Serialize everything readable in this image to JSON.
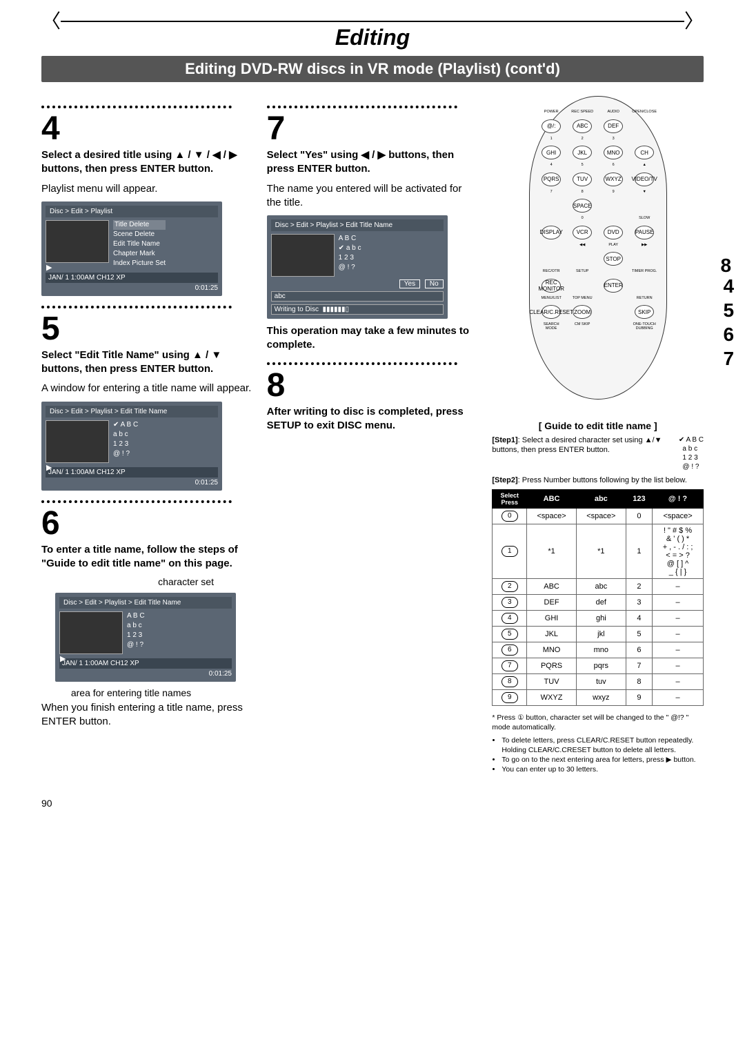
{
  "header": {
    "chapter": "Editing",
    "section": "Editing DVD-RW discs in VR mode (Playlist) (cont'd)"
  },
  "page_number": "90",
  "steps": {
    "s4": {
      "num": "4",
      "title": "Select a desired title using ▲ / ▼ / ◀ / ▶ buttons, then press ENTER button.",
      "body": "Playlist menu will appear."
    },
    "s5": {
      "num": "5",
      "title": "Select \"Edit Title Name\" using ▲ / ▼ buttons, then press ENTER button.",
      "body": "A window for entering a title name will appear."
    },
    "s6": {
      "num": "6",
      "title": "To enter a title name, follow the steps of \"Guide to edit title name\" on this page.",
      "cap1": "character set",
      "cap2": "area for entering title names",
      "body": "When you finish entering a title name, press ENTER button."
    },
    "s7": {
      "num": "7",
      "title": "Select \"Yes\" using ◀ / ▶ buttons, then press ENTER button.",
      "body": "The name you entered will be activated for the title.",
      "note": "This operation may take a few minutes to complete."
    },
    "s8": {
      "num": "8",
      "title": "After writing to disc is completed, press SETUP to exit DISC menu."
    }
  },
  "osd": {
    "crumb_playlist": "Disc > Edit > Playlist",
    "crumb_edit_title": "Disc > Edit > Playlist > Edit Title Name",
    "menu_items": {
      "title_delete": "Title Delete",
      "scene_delete": "Scene Delete",
      "edit_title_name": "Edit Title Name",
      "chapter_mark": "Chapter Mark",
      "index_picture": "Index Picture Set"
    },
    "status_line": "JAN/ 1   1:00AM   CH12    XP",
    "time": "0:01:25",
    "charset": {
      "l1": "A B C",
      "l2": "a b c",
      "l3": "1 2 3",
      "l4": "@ ! ?"
    },
    "yes": "Yes",
    "no": "No",
    "abc_field": "abc",
    "writing": "Writing to Disc"
  },
  "remote": {
    "side_labels": {
      "a": "8",
      "b": "4",
      "c": "5",
      "d": "6",
      "e": "7"
    },
    "rows": [
      [
        "POWER",
        "REC SPEED",
        "AUDIO",
        "OPEN/CLOSE"
      ],
      [
        "@/:",
        "ABC",
        "DEF",
        ""
      ],
      [
        "1",
        "2",
        "3",
        ""
      ],
      [
        "GHI",
        "JKL",
        "MNO",
        "CH"
      ],
      [
        "4",
        "5",
        "6",
        "▲"
      ],
      [
        "PQRS",
        "TUV",
        "WXYZ",
        "VIDEO/TV"
      ],
      [
        "7",
        "8",
        "9",
        "▼"
      ],
      [
        "",
        "SPACE",
        "",
        ""
      ],
      [
        "",
        "0",
        "",
        "SLOW"
      ],
      [
        "DISPLAY",
        "VCR",
        "DVD",
        "PAUSE"
      ],
      [
        "",
        "◀◀",
        "PLAY",
        "▶▶"
      ],
      [
        "",
        "",
        "STOP",
        ""
      ],
      [
        "REC/OTR",
        "SETUP",
        "",
        "TIMER PROG."
      ],
      [
        "REC MONITOR",
        "",
        "ENTER",
        ""
      ],
      [
        "MENU/LIST",
        "TOP MENU",
        "",
        "RETURN"
      ],
      [
        "CLEAR/C.RESET",
        "ZOOM",
        "",
        "SKIP"
      ],
      [
        "SEARCH MODE",
        "CM SKIP",
        "",
        "ONE-TOUCH DUBBING"
      ]
    ]
  },
  "guide": {
    "title": "[ Guide to edit title name ]",
    "step1_label": "[Step1]",
    "step1_text": ": Select a desired character set using ▲/▼ buttons, then press ENTER button.",
    "step2_label": "[Step2]",
    "step2_text": ": Press Number buttons following by the list below.",
    "table_header_corner": "Select\nPress",
    "headers": [
      "ABC",
      "abc",
      "123",
      "@ ! ?"
    ],
    "rows": [
      {
        "n": "0",
        "c": [
          "<space>",
          "<space>",
          "0",
          "<space>"
        ]
      },
      {
        "n": "1",
        "c": [
          "*1",
          "*1",
          "1",
          "! \" # $ %\n& ' ( ) *\n+ , - . / : ;\n< = > ?\n@ [ ] ^\n_ { | }"
        ]
      },
      {
        "n": "2",
        "c": [
          "ABC",
          "abc",
          "2",
          "–"
        ]
      },
      {
        "n": "3",
        "c": [
          "DEF",
          "def",
          "3",
          "–"
        ]
      },
      {
        "n": "4",
        "c": [
          "GHI",
          "ghi",
          "4",
          "–"
        ]
      },
      {
        "n": "5",
        "c": [
          "JKL",
          "jkl",
          "5",
          "–"
        ]
      },
      {
        "n": "6",
        "c": [
          "MNO",
          "mno",
          "6",
          "–"
        ]
      },
      {
        "n": "7",
        "c": [
          "PQRS",
          "pqrs",
          "7",
          "–"
        ]
      },
      {
        "n": "8",
        "c": [
          "TUV",
          "tuv",
          "8",
          "–"
        ]
      },
      {
        "n": "9",
        "c": [
          "WXYZ",
          "wxyz",
          "9",
          "–"
        ]
      }
    ],
    "star_note": "* Press ① button, character set will be changed to the \" @!? \" mode automatically.",
    "bullets": [
      "To delete letters, press CLEAR/C.RESET button repeatedly. Holding CLEAR/C.CRESET button to delete all letters.",
      "To go on to the next entering area for letters, press ▶ button.",
      "You can enter up to 30 letters."
    ]
  }
}
